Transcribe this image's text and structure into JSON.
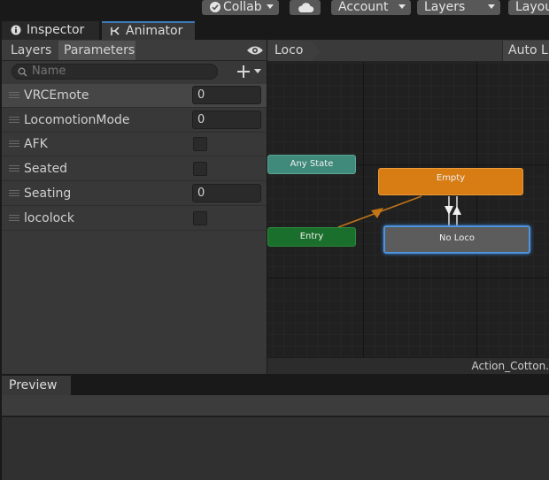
{
  "toolbar": {
    "collab_label": "Collab",
    "account_label": "Account",
    "layers_label": "Layers",
    "layout_label": "Layou"
  },
  "window_tabs": {
    "inspector": "Inspector",
    "animator": "Animator"
  },
  "left_panel": {
    "tabs": {
      "layers": "Layers",
      "parameters": "Parameters"
    },
    "search_placeholder": "Name",
    "parameters": [
      {
        "name": "VRCEmote",
        "type": "int",
        "value": "0"
      },
      {
        "name": "LocomotionMode",
        "type": "int",
        "value": "0"
      },
      {
        "name": "AFK",
        "type": "bool",
        "checked": false
      },
      {
        "name": "Seated",
        "type": "bool",
        "checked": false
      },
      {
        "name": "Seating",
        "type": "int",
        "value": "0"
      },
      {
        "name": "locolock",
        "type": "bool",
        "checked": false
      }
    ]
  },
  "graph": {
    "breadcrumb": "Loco",
    "auto_live": "Auto Li",
    "states": {
      "any_state": "Any State",
      "entry": "Entry",
      "empty": "Empty",
      "no_loco": "No Loco"
    },
    "footer_filename": "Action_Cotton.",
    "colors": {
      "any_state": "#3f8a7a",
      "entry": "#196f2b",
      "empty": "#d87c14",
      "no_loco": "#5c5c5c",
      "selection": "#4c93dd"
    }
  },
  "preview": {
    "tab_label": "Preview"
  },
  "icons": {
    "collab": "check-circle-icon",
    "cloud": "cloud-icon",
    "inspector": "info-icon",
    "animator": "animator-icon",
    "visibility": "eye-icon",
    "search": "search-icon",
    "add": "plus-icon"
  }
}
